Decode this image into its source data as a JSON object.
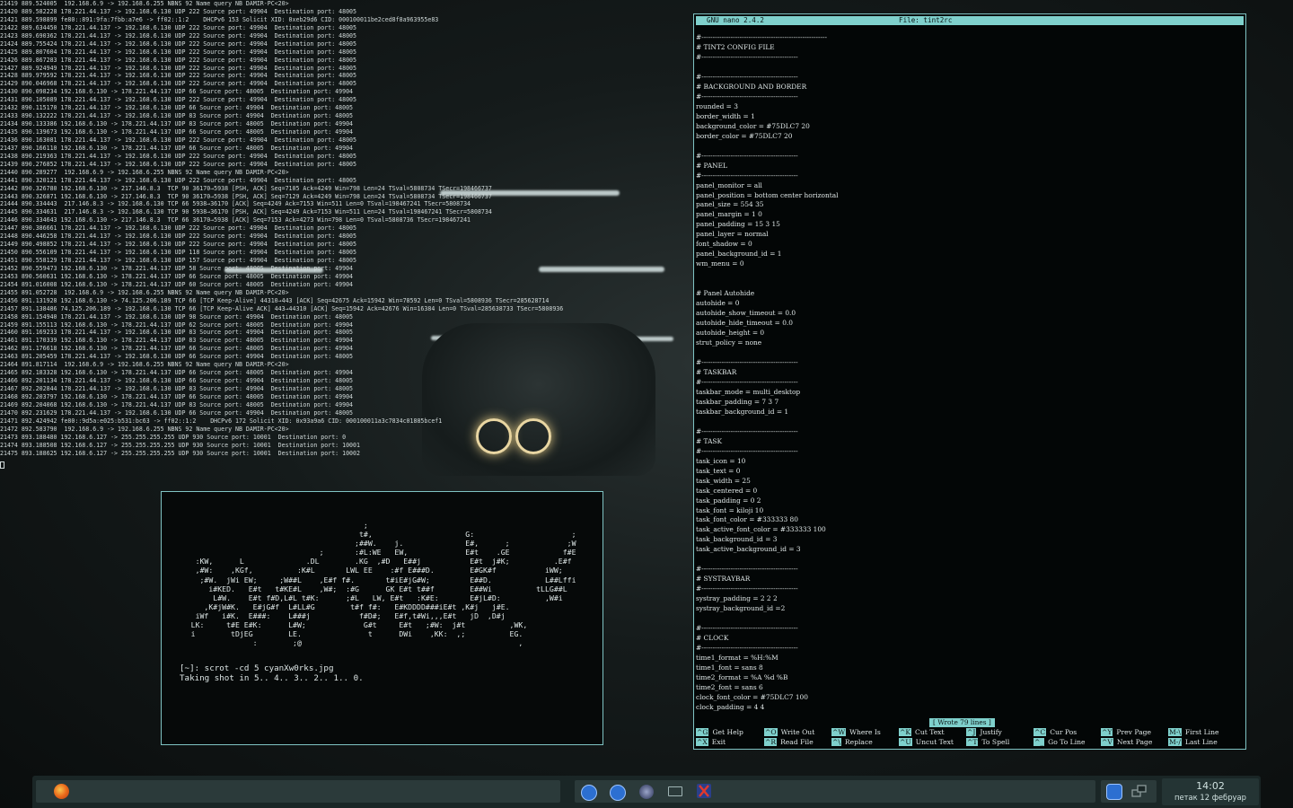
{
  "colors": {
    "accent": "#7fd0cc",
    "terminal_fg": "#cfd8d8",
    "panel_bg": "#1a2626"
  },
  "log_terminal": {
    "lines": [
      "21419 889.524005  192.168.6.9 -> 192.168.6.255 NBNS 92 Name query NB DAMIR-PC<20>",
      "21420 889.582228 178.221.44.137 -> 192.168.6.130 UDP 222 Source port: 49904  Destination port: 48005",
      "21421 889.598899 fe80::891:9fa:7fbb:a7e6 -> ff02::1:2    DHCPv6 153 Solicit XID: 0xeb29d6 CID: 000100011be2ced8f8a963955e83",
      "21422 889.634450 178.221.44.137 -> 192.168.6.130 UDP 222 Source port: 49904  Destination port: 48005",
      "21423 889.690362 178.221.44.137 -> 192.168.6.130 UDP 222 Source port: 49904  Destination port: 48005",
      "21424 889.755424 178.221.44.137 -> 192.168.6.130 UDP 222 Source port: 49904  Destination port: 48005",
      "21425 889.807604 178.221.44.137 -> 192.168.6.130 UDP 222 Source port: 49904  Destination port: 48005",
      "21426 889.867283 178.221.44.137 -> 192.168.6.130 UDP 222 Source port: 49904  Destination port: 48005",
      "21427 889.924949 178.221.44.137 -> 192.168.6.130 UDP 222 Source port: 49904  Destination port: 48005",
      "21428 889.979592 178.221.44.137 -> 192.168.6.130 UDP 222 Source port: 49904  Destination port: 48005",
      "21429 890.046968 178.221.44.137 -> 192.168.6.130 UDP 222 Source port: 49904  Destination port: 48005",
      "21430 890.098234 192.168.6.130 -> 178.221.44.137 UDP 66 Source port: 48005  Destination port: 49904",
      "21431 890.105089 178.221.44.137 -> 192.168.6.130 UDP 222 Source port: 49904  Destination port: 48005",
      "21432 890.115170 178.221.44.137 -> 192.168.6.130 UDP 66 Source port: 49904  Destination port: 48005",
      "21433 890.132222 178.221.44.137 -> 192.168.6.130 UDP 83 Source port: 49904  Destination port: 48005",
      "21434 890.133386 192.168.6.130 -> 178.221.44.137 UDP 83 Source port: 48005  Destination port: 49904",
      "21435 890.139673 192.168.6.130 -> 178.221.44.137 UDP 66 Source port: 48005  Destination port: 49904",
      "21436 890.163081 178.221.44.137 -> 192.168.6.130 UDP 222 Source port: 49904  Destination port: 48005",
      "21437 890.166110 192.168.6.130 -> 178.221.44.137 UDP 66 Source port: 48005  Destination port: 49904",
      "21438 890.219363 178.221.44.137 -> 192.168.6.130 UDP 222 Source port: 49904  Destination port: 48005",
      "21439 890.276852 178.221.44.137 -> 192.168.6.130 UDP 222 Source port: 49904  Destination port: 48005",
      "21440 890.289277  192.168.6.9 -> 192.168.6.255 NBNS 92 Name query NB DAMIR-PC<20>",
      "21441 890.320121 178.221.44.137 -> 192.168.6.130 UDP 222 Source port: 49904  Destination port: 48005",
      "21442 890.326780 192.168.6.130 -> 217.146.8.3  TCP 90 36170→5938 [PSH, ACK] Seq=7105 Ack=4249 Win=798 Len=24 TSval=5808734 TSecr=198466737",
      "21443 890.326871 192.168.6.130 -> 217.146.8.3  TCP 90 36170→5938 [PSH, ACK] Seq=7129 Ack=4249 Win=798 Len=24 TSval=5808734 TSecr=198466737",
      "21444 890.334443  217.146.8.3 -> 192.168.6.130 TCP 66 5938→36170 [ACK] Seq=4249 Ack=7153 Win=511 Len=0 TSval=198467241 TSecr=5808734",
      "21445 890.334631  217.146.8.3 -> 192.168.6.130 TCP 90 5938→36170 [PSH, ACK] Seq=4249 Ack=7153 Win=511 Len=24 TSval=198467241 TSecr=5808734",
      "21446 890.334643 192.168.6.130 -> 217.146.8.3  TCP 66 36170→5938 [ACK] Seq=7153 Ack=4273 Win=798 Len=0 TSval=5808736 TSecr=198467241",
      "21447 890.386661 178.221.44.137 -> 192.168.6.130 UDP 222 Source port: 49904  Destination port: 48005",
      "21448 890.446258 178.221.44.137 -> 192.168.6.130 UDP 222 Source port: 49904  Destination port: 48005",
      "21449 890.498852 178.221.44.137 -> 192.168.6.130 UDP 222 Source port: 49904  Destination port: 48005",
      "21450 890.556109 178.221.44.137 -> 192.168.6.130 UDP 118 Source port: 49904  Destination port: 48005",
      "21451 890.558129 178.221.44.137 -> 192.168.6.130 UDP 157 Source port: 49904  Destination port: 48005",
      "21452 890.559473 192.168.6.130 -> 178.221.44.137 UDP 58 Source port: 48005  Destination port: 49904",
      "21453 890.560631 192.168.6.130 -> 178.221.44.137 UDP 66 Source port: 48005  Destination port: 49904",
      "21454 891.016008 192.168.6.130 -> 178.221.44.137 UDP 60 Source port: 48005  Destination port: 49904",
      "21455 891.052728  192.168.6.9 -> 192.168.6.255 NBNS 92 Name query NB DAMIR-PC<20>",
      "21456 891.131928 192.168.6.130 -> 74.125.206.189 TCP 66 [TCP Keep-Alive] 44310→443 [ACK] Seq=42675 Ack=15942 Win=78592 Len=0 TSval=5808936 TSecr=285628714",
      "21457 891.138486 74.125.206.189 -> 192.168.6.130 TCP 66 [TCP Keep-Alive ACK] 443→44310 [ACK] Seq=15942 Ack=42676 Win=16384 Len=0 TSval=285638733 TSecr=5808936",
      "21458 891.154940 178.221.44.137 -> 192.168.6.130 UDP 98 Source port: 49904  Destination port: 48005",
      "21459 891.155113 192.168.6.130 -> 178.221.44.137 UDP 62 Source port: 48005  Destination port: 49904",
      "21460 891.169233 178.221.44.137 -> 192.168.6.130 UDP 83 Source port: 49904  Destination port: 48005",
      "21461 891.170339 192.168.6.130 -> 178.221.44.137 UDP 83 Source port: 48005  Destination port: 49904",
      "21462 891.176618 192.168.6.130 -> 178.221.44.137 UDP 66 Source port: 48005  Destination port: 49904",
      "21463 891.205459 178.221.44.137 -> 192.168.6.130 UDP 66 Source port: 49904  Destination port: 48005",
      "21464 891.817114  192.168.6.9 -> 192.168.6.255 NBNS 92 Name query NB DAMIR-PC<20>",
      "21465 892.183328 192.168.6.130 -> 178.221.44.137 UDP 66 Source port: 48005  Destination port: 49904",
      "21466 892.201134 178.221.44.137 -> 192.168.6.130 UDP 66 Source port: 49904  Destination port: 48005",
      "21467 892.202844 178.221.44.137 -> 192.168.6.130 UDP 83 Source port: 49904  Destination port: 48005",
      "21468 892.203797 192.168.6.130 -> 178.221.44.137 UDP 66 Source port: 48005  Destination port: 49904",
      "21469 892.204068 192.168.6.130 -> 178.221.44.137 UDP 83 Source port: 48005  Destination port: 49904",
      "21470 892.231629 178.221.44.137 -> 192.168.6.130 UDP 66 Source port: 49904  Destination port: 48005",
      "21471 892.424942 fe80::9d5a:e025:b531:bc63 -> ff02::1:2    DHCPv6 172 Solicit XID: 0x93a9a6 CID: 000100011a3c7834c01885bcef1",
      "21472 892.583790  192.168.6.9 -> 192.168.6.255 NBNS 92 Name query NB DAMIR-PC<20>",
      "21473 893.188480 192.168.6.127 -> 255.255.255.255 UDP 930 Source port: 10001  Destination port: 0",
      "21474 893.188508 192.168.6.127 -> 255.255.255.255 UDP 930 Source port: 10001  Destination port: 10001",
      "21475 893.188625 192.168.6.127 -> 255.255.255.255 UDP 930 Source port: 10001  Destination port: 10002"
    ]
  },
  "scrot_terminal": {
    "ascii_art": "                                            ;\n                                           t#,                     G:                      ;\n                                          ;##W.    j.              E#,      ;             ;W\n                                  ;       :#L:WE   EW,             E#t    .GE            f#E\n      :KW,      L              .DL        .KG  ,#D   E##j           E#t  j#K;          .E#f\n      ,#W:    ,KGf,          :K#L       LWL EE    :#f E###D.        E#GK#f           iWW;\n       ;#W.  jWi EW;     ;W##L    ,E#f f#.       t#iE#jG#W;         E##D.            L##Lffi\n         i#KED.   E#t   t#KE#L    ,W#;  :#G      GK E#t t##f        E##Wi          tLLG##L\n          L#W.    E#t f#D,L#L t#K:      ;#L   LW, E#t   :K#E:       E#jL#D:          ,W#i\n        ,K#jW#K.   E#jG#f  L#LL#G        t#f f#:   E#KDDDD###iE#t ,K#j   j#E.\n      iWf   i#K.  E###:    L###j           f#D#;   E#f,t#Wi,,,E#t   jD  ,D#j\n     LK:     t#E E#K:      L#W;             G#t     E#t   ;#W:  j#t          ,WK,\n     i        tDjEG        LE.               t      DWi    ,KK:  ,;          EG.\n                   :        ;@                                                 ,",
    "command_line": "[~]: scrot -cd 5 cyanXw0rks.jpg",
    "output_line": "Taking shot in 5.. 4.. 3.. 2.. 1.. 0."
  },
  "nano": {
    "version": "GNU nano 2.4.2",
    "file_label": "File: tint2rc",
    "status_message": "[ Wrote 79 lines ]",
    "lines": [
      "#--------------------------------------------------------",
      "# TINT2 CONFIG FILE",
      "#-------------------------------------------",
      "",
      "#-------------------------------------------",
      "# BACKGROUND AND BORDER",
      "#-------------------------------------------",
      "rounded = 3",
      "border_width = 1",
      "background_color = #75DLC7 20",
      "border_color = #75DLC7 20",
      "",
      "#-------------------------------------------",
      "# PANEL",
      "#-------------------------------------------",
      "panel_monitor = all",
      "panel_position = bottom center horizontal",
      "panel_size = 554 35",
      "panel_margin = 1 0",
      "panel_padding = 15 3 15",
      "panel_layer = normal",
      "font_shadow = 0",
      "panel_background_id = 1",
      "wm_menu = 0",
      "",
      "",
      "# Panel Autohide",
      "autohide = 0",
      "autohide_show_timeout = 0.0",
      "autohide_hide_timeout = 0.0",
      "autohide_height = 0",
      "strut_policy = none",
      "",
      "#-------------------------------------------",
      "# TASKBAR",
      "#-------------------------------------------",
      "taskbar_mode = multi_desktop",
      "taskbar_padding = 7 3 7",
      "taskbar_background_id = 1",
      "",
      "#-------------------------------------------",
      "# TASK",
      "#-------------------------------------------",
      "task_icon = 10",
      "task_text = 0",
      "task_width = 25",
      "task_centered = 0",
      "task_padding = 0 2",
      "task_font = kiloji 10",
      "task_font_color = #333333 80",
      "task_active_font_color = #333333 100",
      "task_background_id = 3",
      "task_active_background_id = 3",
      "",
      "#-------------------------------------------",
      "# SYSTRAYBAR",
      "#-------------------------------------------",
      "systray_padding = 2 2 2",
      "systray_background_id =2",
      "",
      "#-------------------------------------------",
      "# CLOCK",
      "#-------------------------------------------",
      "time1_format = %H:%M",
      "time1_font = sans 8",
      "time2_format = %A %d %B",
      "time2_font = sans 6",
      "clock_font_color = #75DLC7 100",
      "clock_padding = 4 4"
    ],
    "shortcuts": [
      {
        "key": "^G",
        "label": "Get Help"
      },
      {
        "key": "^O",
        "label": "Write Out"
      },
      {
        "key": "^W",
        "label": "Where Is"
      },
      {
        "key": "^K",
        "label": "Cut Text"
      },
      {
        "key": "^J",
        "label": "Justify"
      },
      {
        "key": "^C",
        "label": "Cur Pos"
      },
      {
        "key": "^Y",
        "label": "Prev Page"
      },
      {
        "key": "M-\\",
        "label": "First Line"
      },
      {
        "key": "^X",
        "label": "Exit"
      },
      {
        "key": "^R",
        "label": "Read File"
      },
      {
        "key": "^\\",
        "label": "Replace"
      },
      {
        "key": "^U",
        "label": "Uncut Text"
      },
      {
        "key": "^T",
        "label": "To Spell"
      },
      {
        "key": "^_",
        "label": "Go To Line"
      },
      {
        "key": "^V",
        "label": "Next Page"
      },
      {
        "key": "M-/",
        "label": "Last Line"
      }
    ]
  },
  "taskbar": {
    "launchers": [
      {
        "icon": "firefox-icon"
      }
    ],
    "tasks": [
      {
        "icon": "teamviewer-icon"
      },
      {
        "icon": "teamviewer-icon"
      },
      {
        "icon": "disk-utility-icon"
      },
      {
        "icon": "window-icon"
      },
      {
        "icon": "x-terminal-icon"
      }
    ],
    "tray": [
      {
        "icon": "teamviewer-tray-icon"
      },
      {
        "icon": "network-icon"
      }
    ],
    "clock": {
      "time": "14:02",
      "date": "петак 12 фебруар"
    }
  }
}
